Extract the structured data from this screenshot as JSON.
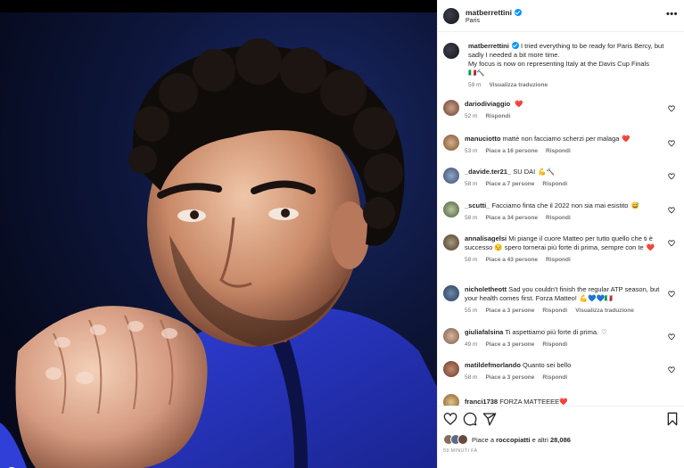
{
  "post": {
    "username": "matberrettini",
    "location": "Paris",
    "more_label": "•••"
  },
  "caption": {
    "username": "matberrettini",
    "line1": "I tried everything to be ready for Paris Bercy, but sadly I needed a bit more time.",
    "line2": "My focus is now on representing Italy at the Davis Cup Finals",
    "line3": "🇮🇹🔨",
    "time": "59 m",
    "translate": "Visualizza traduzione"
  },
  "comments": [
    {
      "username": "dariodiviaggio",
      "text": "",
      "emoji": "❤️",
      "time": "52 m",
      "likes": "",
      "reply": "Rispondi",
      "translate": ""
    },
    {
      "username": "manuciotto",
      "text": "mattè non facciamo scherzi per malaga",
      "emoji": "❤️",
      "time": "53 m",
      "likes": "Piace a 16 persone",
      "reply": "Rispondi",
      "translate": ""
    },
    {
      "username": "_davide.ter21_",
      "text": "SU DAI",
      "emoji": "💪🔨",
      "time": "58 m",
      "likes": "Piace a 7 persone",
      "reply": "Rispondi",
      "translate": ""
    },
    {
      "username": "_scutti_",
      "text": "Facciamo finta che il 2022 non sia mai esistito",
      "emoji": "😅",
      "time": "58 m",
      "likes": "Piace a 34 persone",
      "reply": "Rispondi",
      "translate": ""
    },
    {
      "username": "annalisagelsi",
      "text": "Mi piange il cuore Matteo per tutto quello che ti è successo 😔 spero tornerai più forte di prima, sempre con te",
      "emoji": "❤️",
      "time": "58 m",
      "likes": "Piace a 43 persone",
      "reply": "Rispondi",
      "translate": ""
    },
    {
      "username": "nicholetheott",
      "text": "Sad you couldn't finish the regular ATP season, but your health comes first. Forza Matteo!",
      "emoji": "💪💙💙🇮🇹",
      "time": "55 m",
      "likes": "Piace a 3 persone",
      "reply": "Rispondi",
      "translate": "Visualizza traduzione"
    },
    {
      "username": "giuliafalsina",
      "text": "Ti aspettiamo più forte di prima.",
      "emoji": "♡",
      "time": "49 m",
      "likes": "Piace a 3 persone",
      "reply": "Rispondi",
      "translate": ""
    },
    {
      "username": "matildefmorlando",
      "text": "Quanto sei bello",
      "emoji": "",
      "time": "58 m",
      "likes": "Piace a 3 persone",
      "reply": "Rispondi",
      "translate": ""
    }
  ],
  "partial_comment": {
    "username": "franci1738",
    "text": "FORZA MATTEEEE",
    "emoji": "❤️"
  },
  "likes_summary": {
    "prefix": "Piace a",
    "user": "roccopiatti",
    "suffix": "e altri",
    "count": "28,086"
  },
  "timestamp": "59 MINUTI FA",
  "icons": [
    "heart-icon",
    "comment-icon",
    "share-icon",
    "bookmark-icon",
    "more-icon",
    "verified-icon"
  ],
  "colors": {
    "verified": "#0095f6",
    "heart": "#ed4956",
    "meta": "#737373"
  }
}
